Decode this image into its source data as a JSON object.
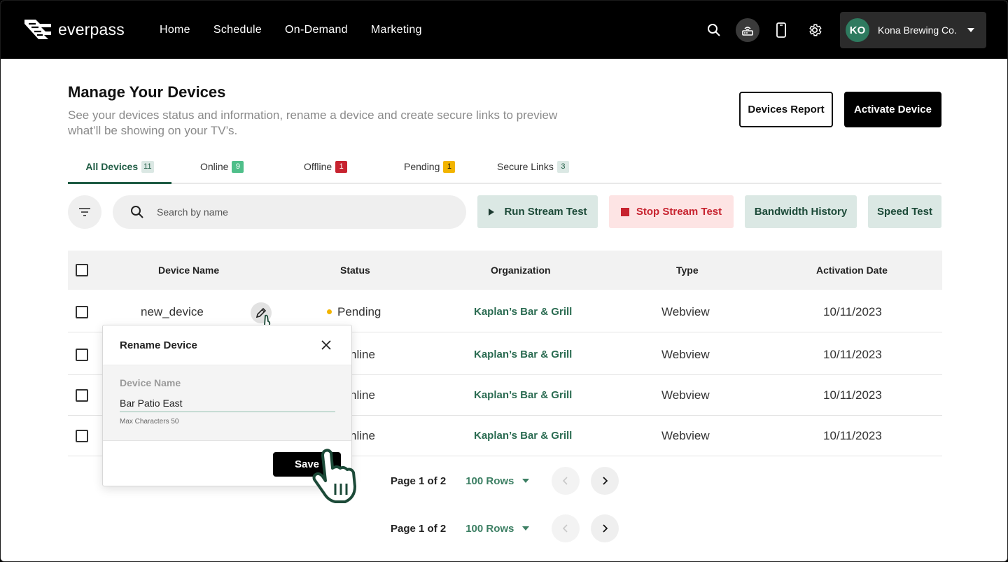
{
  "brand": {
    "name": "everpass"
  },
  "nav": [
    "Home",
    "Schedule",
    "On-Demand",
    "Marketing"
  ],
  "account": {
    "initials": "KO",
    "name": "Kona Brewing Co."
  },
  "page": {
    "title": "Manage Your Devices",
    "subtitle": "See your devices status and information, rename a device and create secure links to preview what’ll be showing on your TV’s.",
    "devices_report": "Devices Report",
    "activate_device": "Activate Device"
  },
  "tabs": [
    {
      "label": "All Devices",
      "count": "11",
      "color": "#dbe8e4",
      "text": "#1f5c44"
    },
    {
      "label": "Online",
      "count": "9",
      "color": "#4fbf8a",
      "text": "#ffffff"
    },
    {
      "label": "Offline",
      "count": "1",
      "color": "#c7232f",
      "text": "#ffffff"
    },
    {
      "label": "Pending",
      "count": "1",
      "color": "#f2b400",
      "text": "#111111"
    },
    {
      "label": "Secure Links",
      "count": "3",
      "color": "#dbe8e4",
      "text": "#1f5c44"
    }
  ],
  "toolbar": {
    "search_placeholder": "Search by name",
    "run_stream": "Run Stream Test",
    "stop_stream": "Stop Stream Test",
    "bandwidth": "Bandwidth History",
    "speed": "Speed Test"
  },
  "table": {
    "columns": [
      "Device Name",
      "Status",
      "Organization",
      "Type",
      "Activation Date"
    ],
    "rows": [
      {
        "name": "new_device",
        "status": "Pending",
        "org": "Kaplan’s Bar & Grill",
        "type": "Webview",
        "date": "10/11/2023"
      },
      {
        "name": "",
        "status": "nline",
        "org": "Kaplan’s Bar & Grill",
        "type": "Webview",
        "date": "10/11/2023"
      },
      {
        "name": "",
        "status": "nline",
        "org": "Kaplan’s Bar & Grill",
        "type": "Webview",
        "date": "10/11/2023"
      },
      {
        "name": "",
        "status": "nline",
        "org": "Kaplan’s Bar & Grill",
        "type": "Webview",
        "date": "10/11/2023"
      }
    ]
  },
  "pagination": {
    "page_label": "Page 1 of 2",
    "rows_label": "100 Rows"
  },
  "modal": {
    "title": "Rename Device",
    "field_label": "Device Name",
    "field_value": "Bar Patio East",
    "hint": "Max Characters 50",
    "save": "Save"
  },
  "colors": {
    "accent": "#1f5c44",
    "header_bg": "#000000",
    "danger": "#c7232f",
    "pending": "#f2b400"
  }
}
